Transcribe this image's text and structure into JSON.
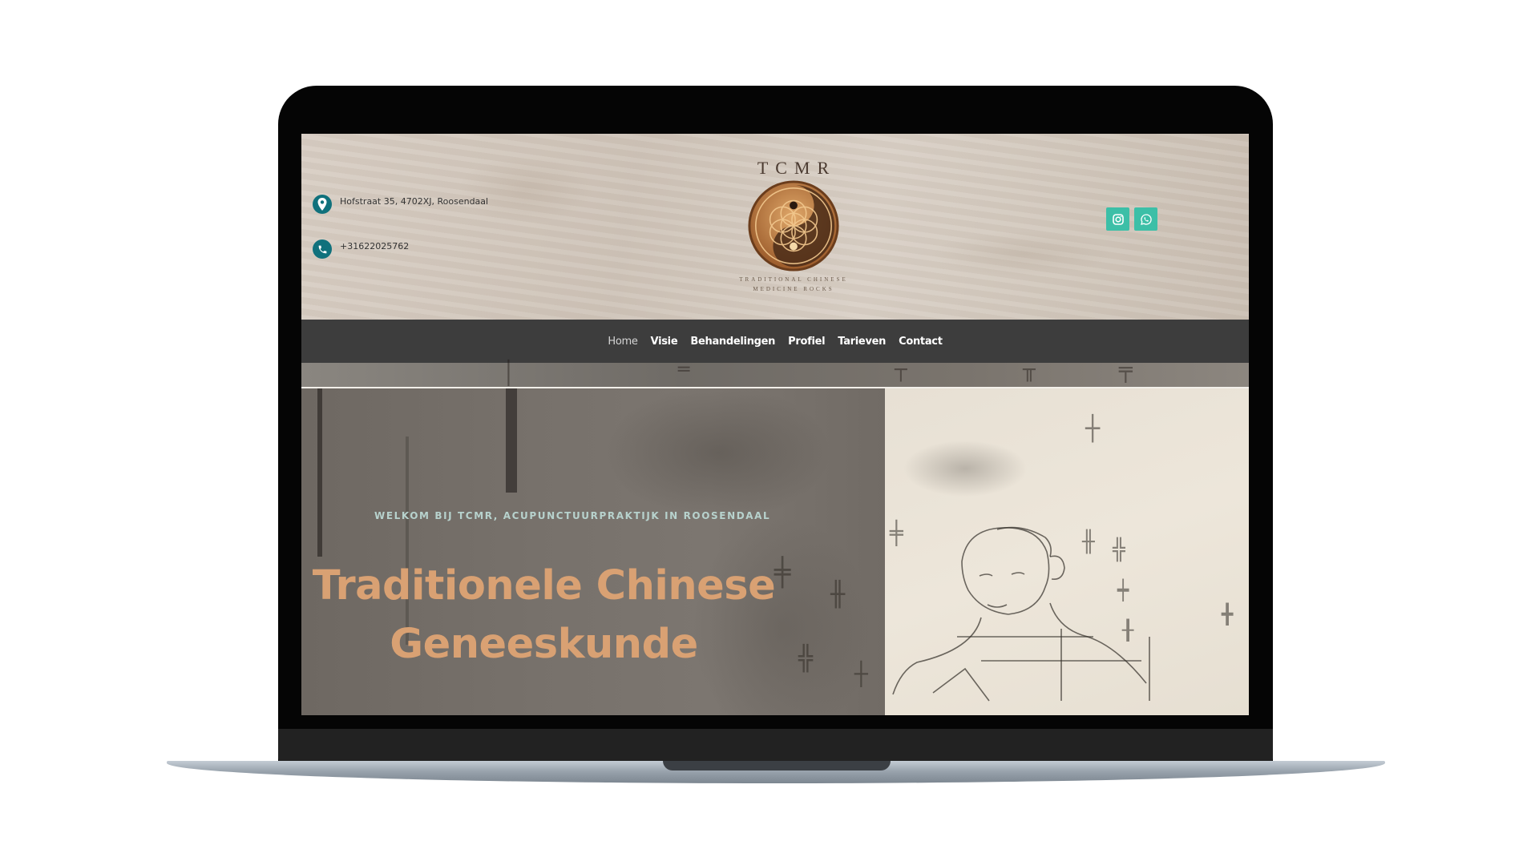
{
  "header": {
    "address": "Hofstraat 35, 4702XJ, Roosendaal",
    "phone": "+31622025762",
    "logo": {
      "title": "TCMR",
      "subtitle_line1": "TRADITIONAL CHINESE",
      "subtitle_line2": "MEDICINE ROCKS"
    },
    "social": [
      {
        "icon": "instagram-icon"
      },
      {
        "icon": "whatsapp-icon"
      }
    ]
  },
  "nav": {
    "items": [
      {
        "label": "Home",
        "active": true
      },
      {
        "label": "Visie"
      },
      {
        "label": "Behandelingen"
      },
      {
        "label": "Profiel"
      },
      {
        "label": "Tarieven"
      },
      {
        "label": "Contact"
      }
    ]
  },
  "hero": {
    "eyebrow": "WELKOM BIJ TCMR, ACUPUNCTUURPRAKTIJK IN ROOSENDAAL",
    "title_line1": "Traditionele Chinese",
    "title_line2": "Geneeskunde"
  },
  "colors": {
    "accent_teal": "#10717c",
    "social_green": "#3cbfa7",
    "nav_bg": "#3d3d3d",
    "hero_title": "#d9a173",
    "eyebrow": "#b7d2cd"
  }
}
